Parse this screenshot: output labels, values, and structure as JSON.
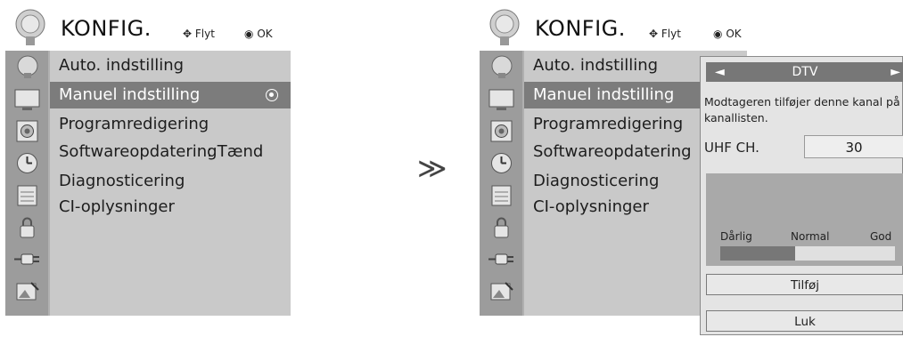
{
  "left_menu": {
    "title": "KONFIG.",
    "hint_move": "Flyt",
    "hint_ok": "OK",
    "items": [
      {
        "label": "Auto. indstilling"
      },
      {
        "label": "Manuel indstilling",
        "selected": true
      },
      {
        "label": "Programredigering"
      },
      {
        "label": "Softwareopdatering",
        "status": ": Tænd"
      },
      {
        "label": "Diagnosticering"
      },
      {
        "label": "CI-oplysninger"
      }
    ]
  },
  "arrow_symbol": "≫",
  "right_menu": {
    "title": "KONFIG.",
    "hint_move": "Flyt",
    "hint_ok": "OK",
    "items": [
      {
        "label": "Auto. indstilling"
      },
      {
        "label": "Manuel indstilling",
        "selected": true
      },
      {
        "label": "Programredigering"
      },
      {
        "label": "Softwareopdatering"
      },
      {
        "label": "Diagnosticering"
      },
      {
        "label": "CI-oplysninger"
      }
    ]
  },
  "popup": {
    "left_arrow": "◄",
    "mode": "DTV",
    "right_arrow": "►",
    "message": "Modtageren tilføjer denne kanal på kanallisten.",
    "channel_label": "UHF CH.",
    "channel_value": "30",
    "signal": {
      "bad": "Dårlig",
      "normal": "Normal",
      "good": "God",
      "level": 0.43
    },
    "add_button": "Tilføj",
    "close_button": "Luk"
  },
  "colors": {
    "selected_row": "#7c7c7c",
    "panel": "#c9c9c9",
    "sidebar": "#9c9c9c"
  }
}
